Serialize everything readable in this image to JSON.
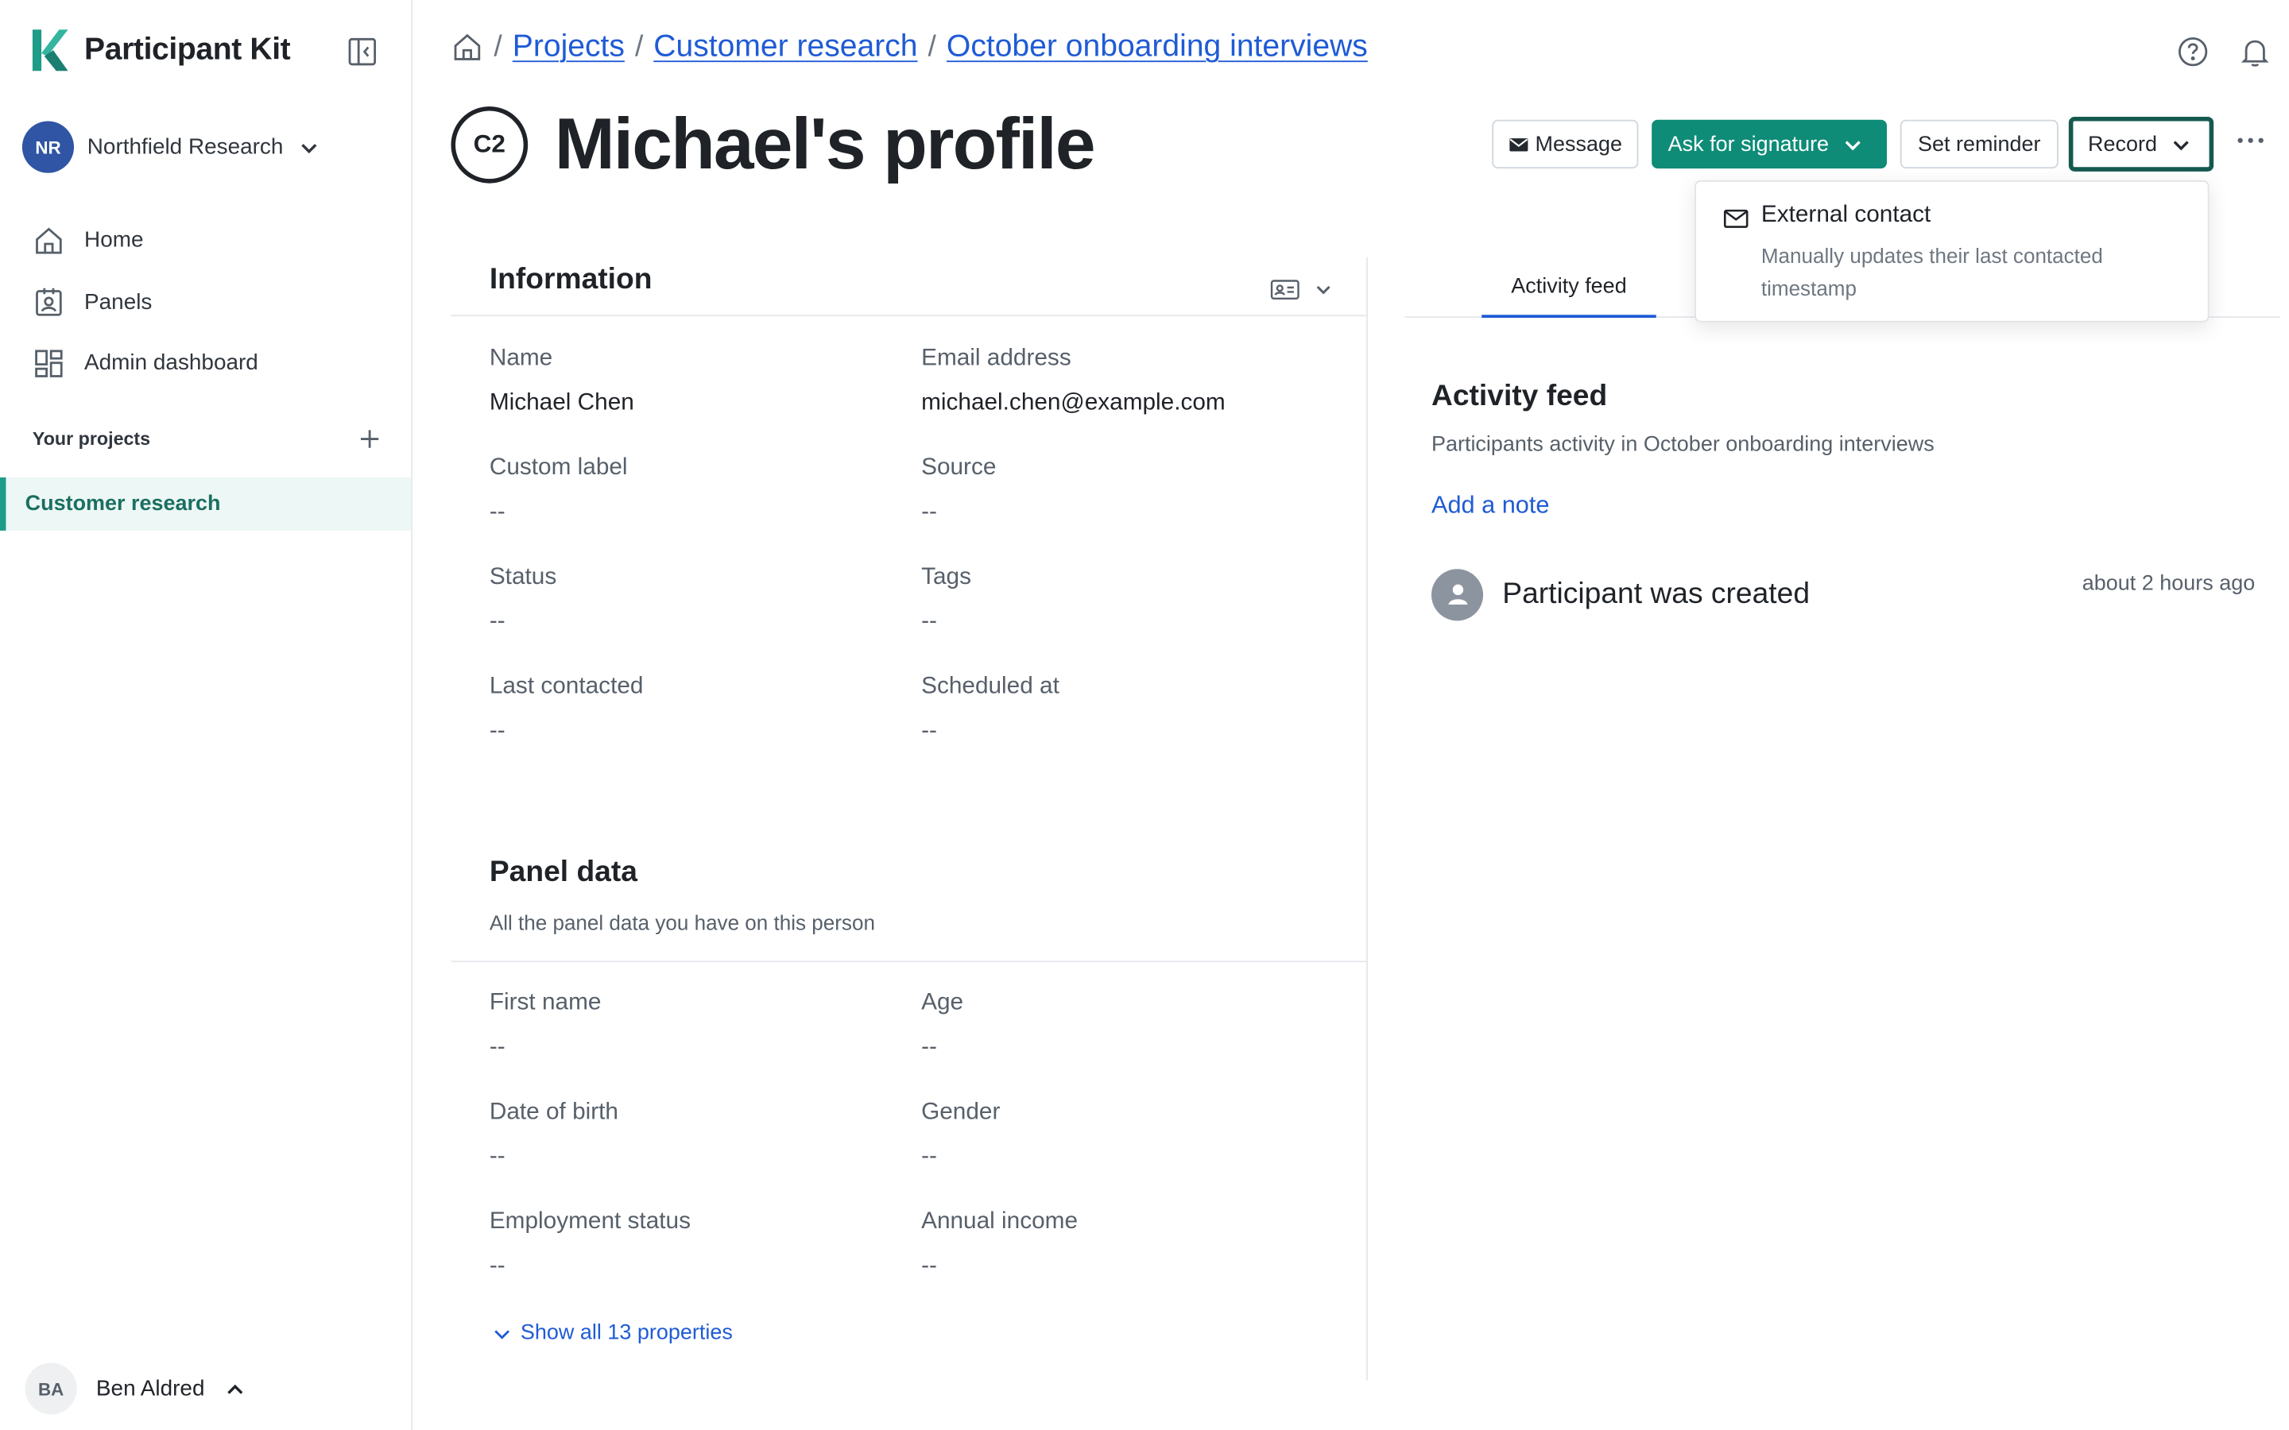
{
  "app": {
    "name": "Participant Kit",
    "accent": "#0e8c78",
    "link_color": "#1f5bd6"
  },
  "sidebar": {
    "org": {
      "initials": "NR",
      "name": "Northfield Research"
    },
    "nav": [
      {
        "label": "Home",
        "icon": "home-icon"
      },
      {
        "label": "Panels",
        "icon": "id-badge-icon"
      },
      {
        "label": "Admin dashboard",
        "icon": "grid-icon"
      }
    ],
    "projects_title": "Your projects",
    "active_project": "Customer research",
    "user": {
      "initials": "BA",
      "name": "Ben Aldred"
    }
  },
  "breadcrumb": {
    "items": [
      "Projects",
      "Customer research",
      "October onboarding interviews"
    ],
    "separator": "/"
  },
  "header": {
    "badge": "C2",
    "title": "Michael's profile"
  },
  "actions": {
    "message": "Message",
    "ask_signature": "Ask for signature",
    "set_reminder": "Set reminder",
    "record": "Record"
  },
  "dropdown": {
    "title": "External contact",
    "description": "Manually updates their last contacted timestamp"
  },
  "information": {
    "title": "Information",
    "fields": [
      {
        "label": "Name",
        "value": "Michael Chen"
      },
      {
        "label": "Email address",
        "value": "michael.chen@example.com"
      },
      {
        "label": "Custom label",
        "value": "--"
      },
      {
        "label": "Source",
        "value": "--"
      },
      {
        "label": "Status",
        "value": "--"
      },
      {
        "label": "Tags",
        "value": "--"
      },
      {
        "label": "Last contacted",
        "value": "--"
      },
      {
        "label": "Scheduled at",
        "value": "--"
      }
    ]
  },
  "panel_data": {
    "title": "Panel data",
    "subtitle": "All the panel data you have on this person",
    "fields": [
      {
        "label": "First name",
        "value": "--"
      },
      {
        "label": "Age",
        "value": "--"
      },
      {
        "label": "Date of birth",
        "value": "--"
      },
      {
        "label": "Gender",
        "value": "--"
      },
      {
        "label": "Employment status",
        "value": "--"
      },
      {
        "label": "Annual income",
        "value": "--"
      }
    ],
    "show_all": "Show all 13 properties"
  },
  "activity": {
    "tab": "Activity feed",
    "title": "Activity feed",
    "subtitle": "Participants activity in October onboarding interviews",
    "add_note": "Add a note",
    "events": [
      {
        "text": "Participant was created",
        "time": "about 2 hours ago"
      }
    ]
  }
}
